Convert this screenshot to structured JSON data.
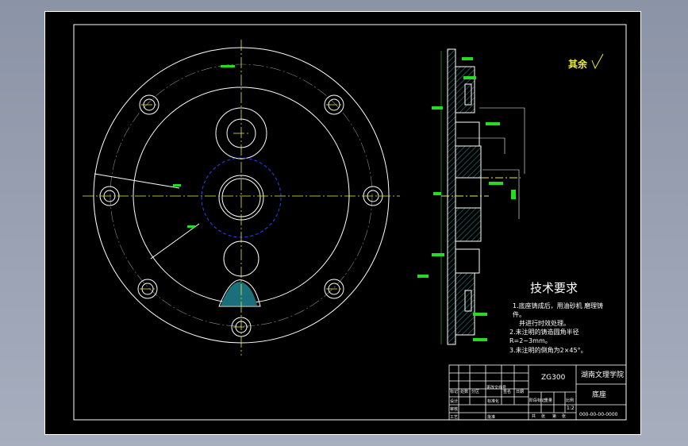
{
  "colors": {
    "background": "#000000",
    "lines": "#ffffff",
    "green": "#22dd22",
    "cyan": "#33cccc",
    "yellow": "#eeee33",
    "blue": "#2244ff",
    "hatch": "#33bbbb"
  },
  "roughness_note": "其余",
  "tech_requirements": {
    "title": "技术要求",
    "line1": "1.底座铸成后，用油砂机 磨理铸",
    "line2": "件。",
    "line3": "并进行时效处理。",
    "line4": "2.未注明的铸造圆角半径",
    "line5": "R=2~3mm。",
    "line6": "3.未注明的倒角为2×45°。"
  },
  "title_block": {
    "material": "ZG300",
    "school": "湖南文理学院",
    "part_name": "底座",
    "scale": "1:2",
    "drawing_no": "000-00-00-0000",
    "headers": [
      "标记",
      "处数",
      "分区",
      "更改文件号",
      "签名",
      "日期"
    ],
    "designer_row": [
      "设计",
      "标准化"
    ],
    "stage_headers": [
      "阶段标记",
      "重量",
      "比例"
    ],
    "sheets": [
      "共",
      "张",
      "第",
      "张"
    ],
    "left_labels": [
      "审核",
      "工艺",
      "批准"
    ]
  }
}
